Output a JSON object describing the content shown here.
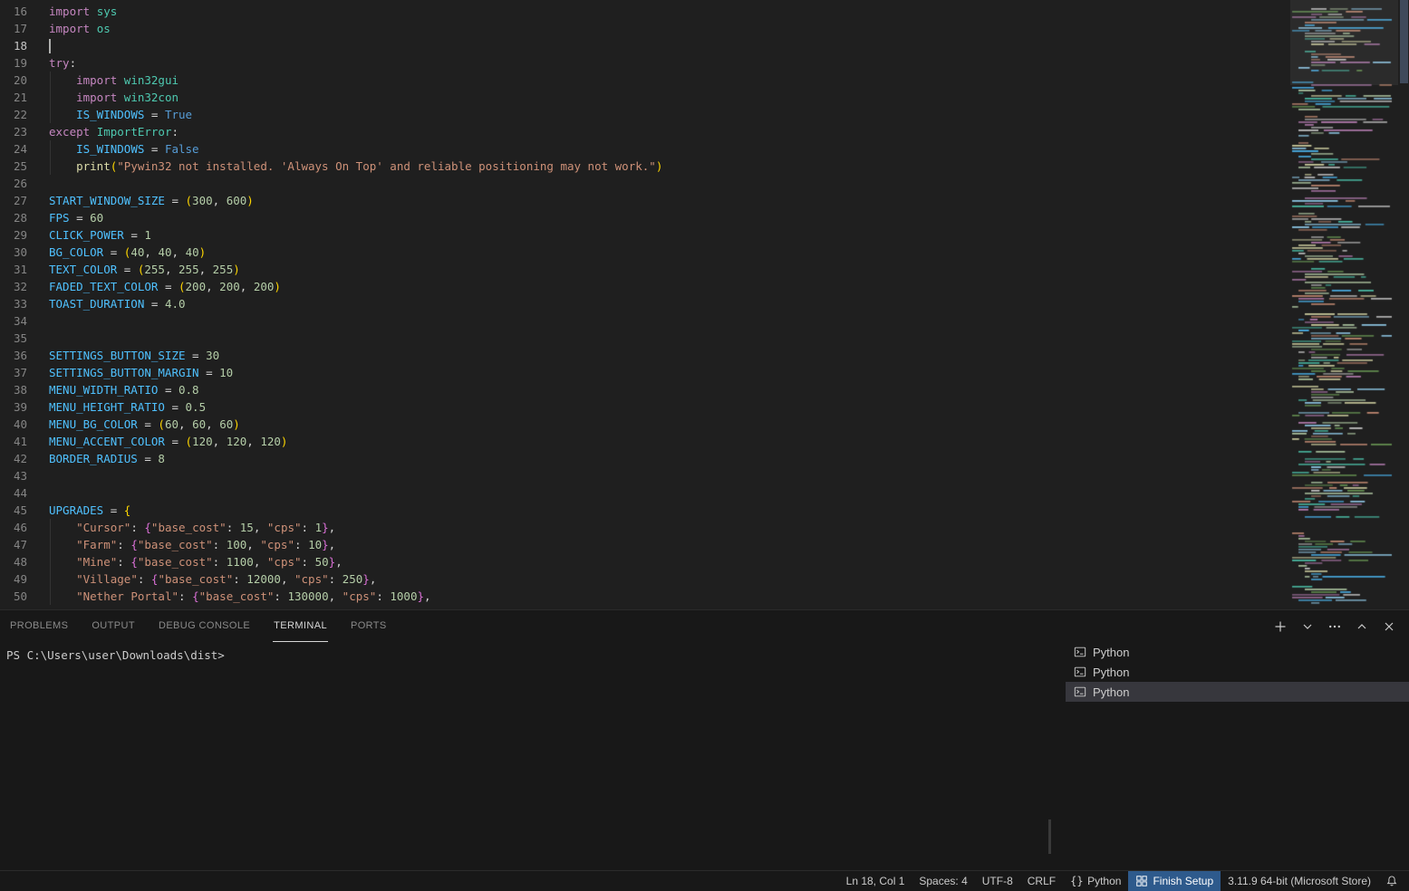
{
  "colors": {
    "editor_bg": "#1f1f1f",
    "panel_bg": "#181818",
    "border": "#2b2b2b",
    "minimap_palette": [
      "#4ec9b0",
      "#ce9178",
      "#9cdcfe",
      "#c586c0",
      "#b5cea8",
      "#d4d4d4",
      "#6a9955",
      "#dcdcaa",
      "#4fc1ff"
    ]
  },
  "editor": {
    "cursor": {
      "line": 18,
      "col": 1
    },
    "lines": [
      {
        "n": 16,
        "t": [
          [
            "k",
            "import"
          ],
          [
            "w",
            " "
          ],
          [
            "m",
            "sys"
          ]
        ]
      },
      {
        "n": 17,
        "t": [
          [
            "k",
            "import"
          ],
          [
            "w",
            " "
          ],
          [
            "m",
            "os"
          ]
        ]
      },
      {
        "n": 18,
        "t": []
      },
      {
        "n": 19,
        "t": [
          [
            "k",
            "try"
          ],
          [
            "o",
            ":"
          ]
        ]
      },
      {
        "n": 20,
        "t": [
          [
            "w",
            "    "
          ],
          [
            "k",
            "import"
          ],
          [
            "w",
            " "
          ],
          [
            "m",
            "win32gui"
          ]
        ]
      },
      {
        "n": 21,
        "t": [
          [
            "w",
            "    "
          ],
          [
            "k",
            "import"
          ],
          [
            "w",
            " "
          ],
          [
            "m",
            "win32con"
          ]
        ]
      },
      {
        "n": 22,
        "t": [
          [
            "w",
            "    "
          ],
          [
            "c",
            "IS_WINDOWS"
          ],
          [
            "o",
            " = "
          ],
          [
            "b",
            "True"
          ]
        ]
      },
      {
        "n": 23,
        "t": [
          [
            "k",
            "except"
          ],
          [
            "w",
            " "
          ],
          [
            "m",
            "ImportError"
          ],
          [
            "o",
            ":"
          ]
        ]
      },
      {
        "n": 24,
        "t": [
          [
            "w",
            "    "
          ],
          [
            "c",
            "IS_WINDOWS"
          ],
          [
            "o",
            " = "
          ],
          [
            "b",
            "False"
          ]
        ]
      },
      {
        "n": 25,
        "t": [
          [
            "w",
            "    "
          ],
          [
            "f",
            "print"
          ],
          [
            "g",
            "("
          ],
          [
            "s",
            "\"Pywin32 not installed. 'Always On Top' and reliable positioning may not work.\""
          ],
          [
            "g",
            ")"
          ]
        ]
      },
      {
        "n": 26,
        "t": []
      },
      {
        "n": 27,
        "t": [
          [
            "c",
            "START_WINDOW_SIZE"
          ],
          [
            "o",
            " = "
          ],
          [
            "g",
            "("
          ],
          [
            "n",
            "300"
          ],
          [
            "o",
            ", "
          ],
          [
            "n",
            "600"
          ],
          [
            "g",
            ")"
          ]
        ]
      },
      {
        "n": 28,
        "t": [
          [
            "c",
            "FPS"
          ],
          [
            "o",
            " = "
          ],
          [
            "n",
            "60"
          ]
        ]
      },
      {
        "n": 29,
        "t": [
          [
            "c",
            "CLICK_POWER"
          ],
          [
            "o",
            " = "
          ],
          [
            "n",
            "1"
          ]
        ]
      },
      {
        "n": 30,
        "t": [
          [
            "c",
            "BG_COLOR"
          ],
          [
            "o",
            " = "
          ],
          [
            "g",
            "("
          ],
          [
            "n",
            "40"
          ],
          [
            "o",
            ", "
          ],
          [
            "n",
            "40"
          ],
          [
            "o",
            ", "
          ],
          [
            "n",
            "40"
          ],
          [
            "g",
            ")"
          ]
        ]
      },
      {
        "n": 31,
        "t": [
          [
            "c",
            "TEXT_COLOR"
          ],
          [
            "o",
            " = "
          ],
          [
            "g",
            "("
          ],
          [
            "n",
            "255"
          ],
          [
            "o",
            ", "
          ],
          [
            "n",
            "255"
          ],
          [
            "o",
            ", "
          ],
          [
            "n",
            "255"
          ],
          [
            "g",
            ")"
          ]
        ]
      },
      {
        "n": 32,
        "t": [
          [
            "c",
            "FADED_TEXT_COLOR"
          ],
          [
            "o",
            " = "
          ],
          [
            "g",
            "("
          ],
          [
            "n",
            "200"
          ],
          [
            "o",
            ", "
          ],
          [
            "n",
            "200"
          ],
          [
            "o",
            ", "
          ],
          [
            "n",
            "200"
          ],
          [
            "g",
            ")"
          ]
        ]
      },
      {
        "n": 33,
        "t": [
          [
            "c",
            "TOAST_DURATION"
          ],
          [
            "o",
            " = "
          ],
          [
            "n",
            "4.0"
          ]
        ]
      },
      {
        "n": 34,
        "t": []
      },
      {
        "n": 35,
        "t": []
      },
      {
        "n": 36,
        "t": [
          [
            "c",
            "SETTINGS_BUTTON_SIZE"
          ],
          [
            "o",
            " = "
          ],
          [
            "n",
            "30"
          ]
        ]
      },
      {
        "n": 37,
        "t": [
          [
            "c",
            "SETTINGS_BUTTON_MARGIN"
          ],
          [
            "o",
            " = "
          ],
          [
            "n",
            "10"
          ]
        ]
      },
      {
        "n": 38,
        "t": [
          [
            "c",
            "MENU_WIDTH_RATIO"
          ],
          [
            "o",
            " = "
          ],
          [
            "n",
            "0.8"
          ]
        ]
      },
      {
        "n": 39,
        "t": [
          [
            "c",
            "MENU_HEIGHT_RATIO"
          ],
          [
            "o",
            " = "
          ],
          [
            "n",
            "0.5"
          ]
        ]
      },
      {
        "n": 40,
        "t": [
          [
            "c",
            "MENU_BG_COLOR"
          ],
          [
            "o",
            " = "
          ],
          [
            "g",
            "("
          ],
          [
            "n",
            "60"
          ],
          [
            "o",
            ", "
          ],
          [
            "n",
            "60"
          ],
          [
            "o",
            ", "
          ],
          [
            "n",
            "60"
          ],
          [
            "g",
            ")"
          ]
        ]
      },
      {
        "n": 41,
        "t": [
          [
            "c",
            "MENU_ACCENT_COLOR"
          ],
          [
            "o",
            " = "
          ],
          [
            "g",
            "("
          ],
          [
            "n",
            "120"
          ],
          [
            "o",
            ", "
          ],
          [
            "n",
            "120"
          ],
          [
            "o",
            ", "
          ],
          [
            "n",
            "120"
          ],
          [
            "g",
            ")"
          ]
        ]
      },
      {
        "n": 42,
        "t": [
          [
            "c",
            "BORDER_RADIUS"
          ],
          [
            "o",
            " = "
          ],
          [
            "n",
            "8"
          ]
        ]
      },
      {
        "n": 43,
        "t": []
      },
      {
        "n": 44,
        "t": []
      },
      {
        "n": 45,
        "t": [
          [
            "c",
            "UPGRADES"
          ],
          [
            "o",
            " = "
          ],
          [
            "g",
            "{"
          ]
        ]
      },
      {
        "n": 46,
        "t": [
          [
            "w",
            "    "
          ],
          [
            "s",
            "\"Cursor\""
          ],
          [
            "o",
            ": "
          ],
          [
            "v",
            "{"
          ],
          [
            "s",
            "\"base_cost\""
          ],
          [
            "o",
            ": "
          ],
          [
            "n",
            "15"
          ],
          [
            "o",
            ", "
          ],
          [
            "s",
            "\"cps\""
          ],
          [
            "o",
            ": "
          ],
          [
            "n",
            "1"
          ],
          [
            "v",
            "}"
          ],
          [
            "o",
            ","
          ]
        ]
      },
      {
        "n": 47,
        "t": [
          [
            "w",
            "    "
          ],
          [
            "s",
            "\"Farm\""
          ],
          [
            "o",
            ": "
          ],
          [
            "v",
            "{"
          ],
          [
            "s",
            "\"base_cost\""
          ],
          [
            "o",
            ": "
          ],
          [
            "n",
            "100"
          ],
          [
            "o",
            ", "
          ],
          [
            "s",
            "\"cps\""
          ],
          [
            "o",
            ": "
          ],
          [
            "n",
            "10"
          ],
          [
            "v",
            "}"
          ],
          [
            "o",
            ","
          ]
        ]
      },
      {
        "n": 48,
        "t": [
          [
            "w",
            "    "
          ],
          [
            "s",
            "\"Mine\""
          ],
          [
            "o",
            ": "
          ],
          [
            "v",
            "{"
          ],
          [
            "s",
            "\"base_cost\""
          ],
          [
            "o",
            ": "
          ],
          [
            "n",
            "1100"
          ],
          [
            "o",
            ", "
          ],
          [
            "s",
            "\"cps\""
          ],
          [
            "o",
            ": "
          ],
          [
            "n",
            "50"
          ],
          [
            "v",
            "}"
          ],
          [
            "o",
            ","
          ]
        ]
      },
      {
        "n": 49,
        "t": [
          [
            "w",
            "    "
          ],
          [
            "s",
            "\"Village\""
          ],
          [
            "o",
            ": "
          ],
          [
            "v",
            "{"
          ],
          [
            "s",
            "\"base_cost\""
          ],
          [
            "o",
            ": "
          ],
          [
            "n",
            "12000"
          ],
          [
            "o",
            ", "
          ],
          [
            "s",
            "\"cps\""
          ],
          [
            "o",
            ": "
          ],
          [
            "n",
            "250"
          ],
          [
            "v",
            "}"
          ],
          [
            "o",
            ","
          ]
        ]
      },
      {
        "n": 50,
        "t": [
          [
            "w",
            "    "
          ],
          [
            "s",
            "\"Nether Portal\""
          ],
          [
            "o",
            ": "
          ],
          [
            "v",
            "{"
          ],
          [
            "s",
            "\"base_cost\""
          ],
          [
            "o",
            ": "
          ],
          [
            "n",
            "130000"
          ],
          [
            "o",
            ", "
          ],
          [
            "s",
            "\"cps\""
          ],
          [
            "o",
            ": "
          ],
          [
            "n",
            "1000"
          ],
          [
            "v",
            "}"
          ],
          [
            "o",
            ","
          ]
        ]
      }
    ]
  },
  "panel": {
    "tabs": [
      {
        "id": "problems",
        "label": "PROBLEMS",
        "active": false
      },
      {
        "id": "output",
        "label": "OUTPUT",
        "active": false
      },
      {
        "id": "debug-console",
        "label": "DEBUG CONSOLE",
        "active": false
      },
      {
        "id": "terminal",
        "label": "TERMINAL",
        "active": true
      },
      {
        "id": "ports",
        "label": "PORTS",
        "active": false
      }
    ],
    "actions": [
      {
        "id": "new-terminal",
        "icon": "plus"
      },
      {
        "id": "launch-profile",
        "icon": "chevron-down"
      },
      {
        "id": "more-actions",
        "icon": "ellipsis"
      },
      {
        "id": "maximize-panel",
        "icon": "chevron-up"
      },
      {
        "id": "close-panel",
        "icon": "close"
      }
    ],
    "terminal": {
      "prompt": "PS C:\\Users\\user\\Downloads\\dist>"
    },
    "terminal_list": [
      {
        "label": "Python",
        "selected": false
      },
      {
        "label": "Python",
        "selected": false
      },
      {
        "label": "Python",
        "selected": true
      }
    ]
  },
  "status_bar": {
    "right": [
      {
        "id": "cursor-position",
        "label": "Ln 18, Col 1"
      },
      {
        "id": "indentation",
        "label": "Spaces: 4"
      },
      {
        "id": "encoding",
        "label": "UTF-8"
      },
      {
        "id": "eol",
        "label": "CRLF"
      },
      {
        "id": "language-mode",
        "label": "Python",
        "icon": "braces"
      },
      {
        "id": "finish-setup",
        "label": "Finish Setup",
        "icon": "grid",
        "highlighted": true
      },
      {
        "id": "python-interpreter",
        "label": "3.11.9 64-bit (Microsoft Store)"
      },
      {
        "id": "notifications",
        "label": "",
        "icon": "bell"
      }
    ]
  }
}
